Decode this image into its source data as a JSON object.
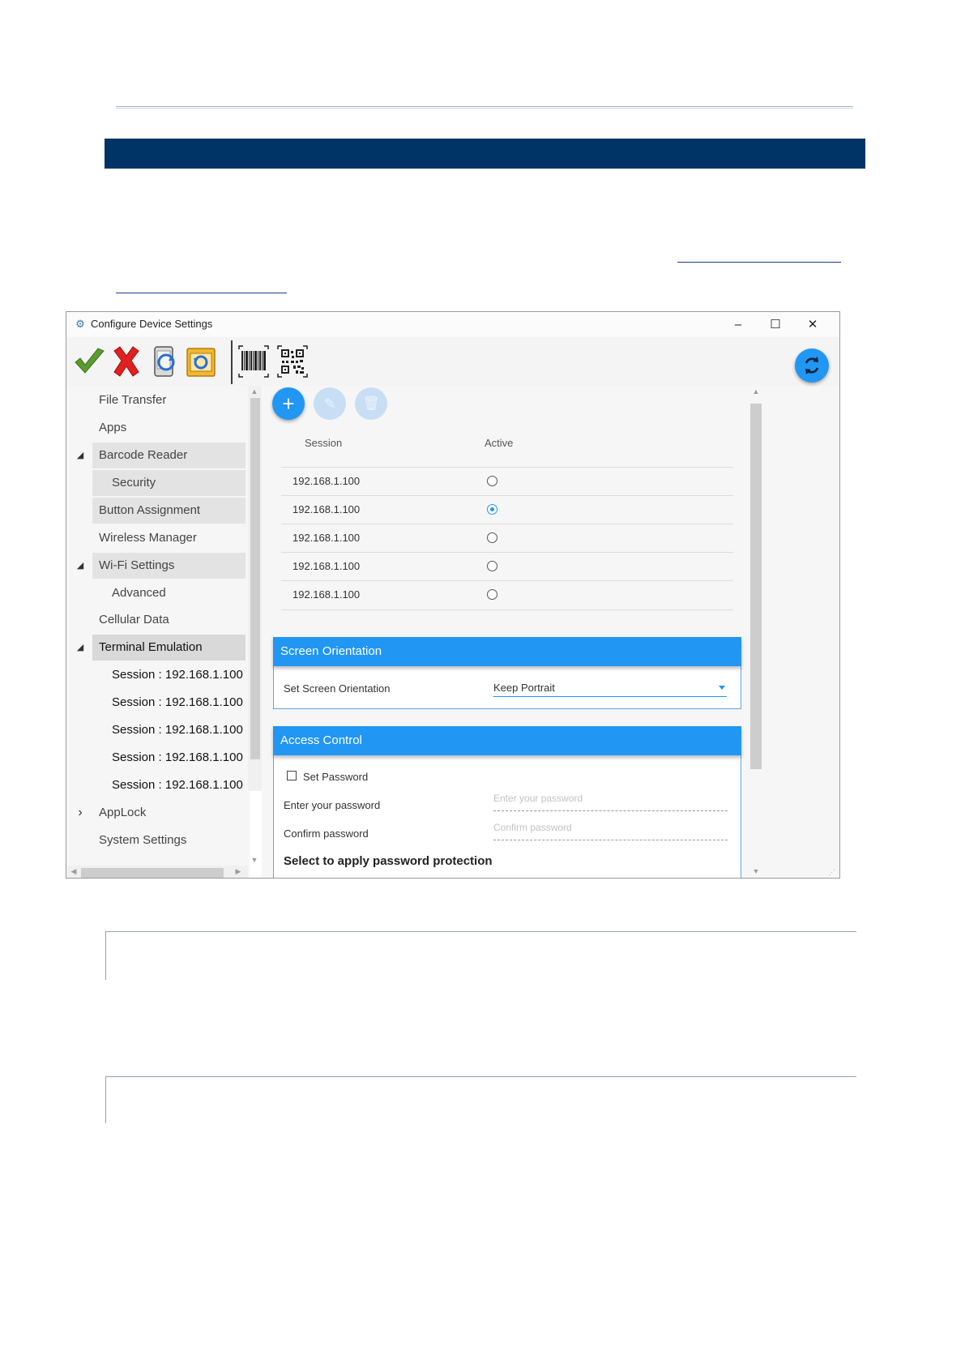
{
  "window": {
    "title": "Configure Device Settings",
    "controls": {
      "minimize": "–",
      "maximize": "☐",
      "close": "✕"
    }
  },
  "toolbar": {
    "icons": [
      "apply-check-icon",
      "cancel-x-icon",
      "device-sync-icon",
      "restore-backup-icon",
      "barcode-icon",
      "qr-code-icon"
    ],
    "sync_icon": "refresh-sync-icon"
  },
  "nav": {
    "items": [
      {
        "label": "File Transfer"
      },
      {
        "label": "Apps"
      },
      {
        "label": "Barcode Reader",
        "expander": "◢"
      },
      {
        "label": "Security"
      },
      {
        "label": "Button Assignment"
      },
      {
        "label": "Wireless Manager"
      },
      {
        "label": "Wi-Fi Settings",
        "expander": "◢"
      },
      {
        "label": "Advanced"
      },
      {
        "label": "Cellular Data"
      },
      {
        "label": "Terminal Emulation",
        "expander": "◢"
      },
      {
        "label": "Session : 192.168.1.100"
      },
      {
        "label": "Session : 192.168.1.100"
      },
      {
        "label": "Session : 192.168.1.100"
      },
      {
        "label": "Session : 192.168.1.100"
      },
      {
        "label": "Session : 192.168.1.100"
      },
      {
        "label": "AppLock",
        "expander": "›"
      },
      {
        "label": "System Settings"
      }
    ]
  },
  "sessions": {
    "actions": {
      "add": "+",
      "edit": "✎",
      "delete": "🗑"
    },
    "headers": {
      "session": "Session",
      "active": "Active"
    },
    "rows": [
      {
        "ip": "192.168.1.100",
        "active": false
      },
      {
        "ip": "192.168.1.100",
        "active": true
      },
      {
        "ip": "192.168.1.100",
        "active": false
      },
      {
        "ip": "192.168.1.100",
        "active": false
      },
      {
        "ip": "192.168.1.100",
        "active": false
      }
    ]
  },
  "screen_orientation": {
    "title": "Screen Orientation",
    "label": "Set Screen Orientation",
    "value": "Keep Portrait"
  },
  "access_control": {
    "title": "Access Control",
    "set_password_label": "Set Password",
    "enter_label": "Enter your password",
    "enter_placeholder": "Enter your password",
    "confirm_label": "Confirm password",
    "confirm_placeholder": "Confirm password",
    "apply_label": "Select to apply password protection"
  },
  "colors": {
    "accent": "#2196f3",
    "banner": "#003366",
    "nav_selected": "#e3e3e3"
  }
}
